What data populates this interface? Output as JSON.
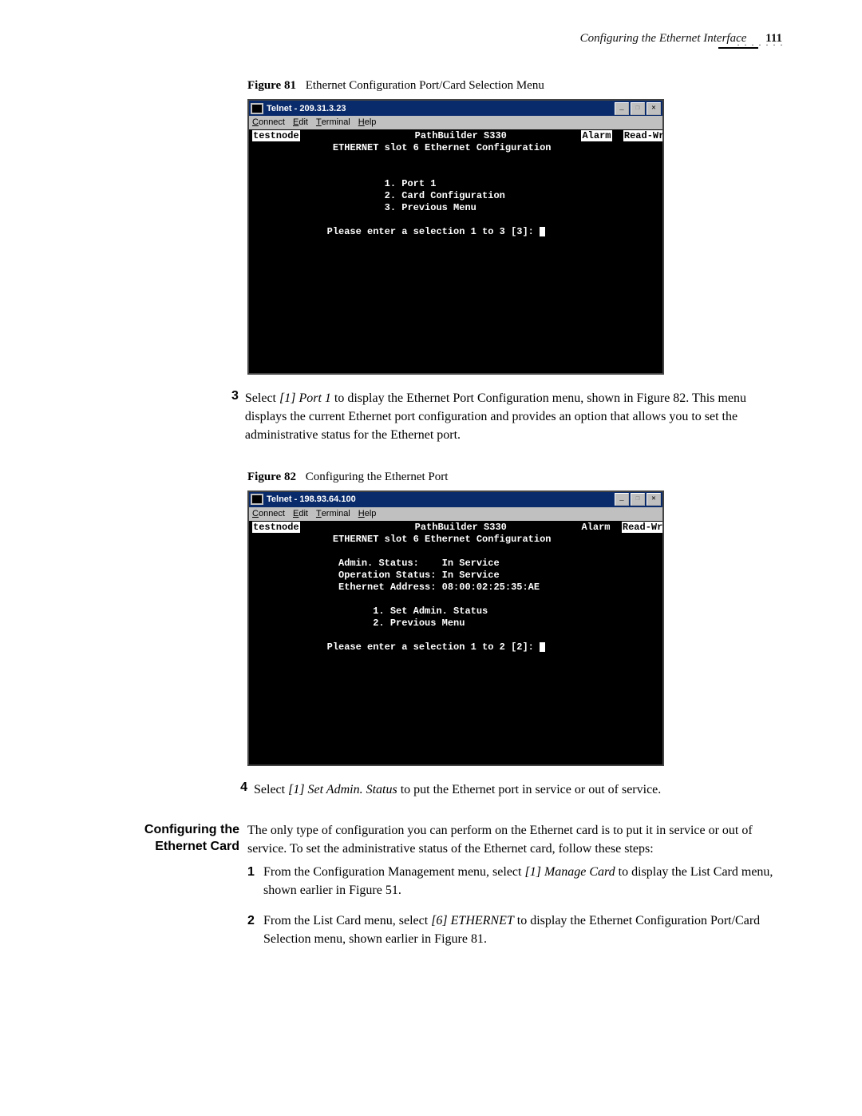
{
  "page": {
    "header_title": "Configuring the Ethernet Interface",
    "page_number": "111"
  },
  "fig81": {
    "caption_label": "Figure 81",
    "caption_text": "Ethernet Configuration Port/Card Selection Menu",
    "titlebar": "Telnet - 209.31.3.23",
    "menus": {
      "connect": "Connect",
      "edit": "Edit",
      "terminal": "Terminal",
      "help": "Help"
    },
    "winbtns": {
      "min": "_",
      "restore": "❐",
      "close": "✕"
    },
    "node": "testnode",
    "product": "PathBuilder S330",
    "alarm": "Alarm",
    "mode": "Read-Write",
    "context": "ETHERNET slot 6 Ethernet Configuration",
    "m1": "1. Port 1",
    "m2": "2. Card Configuration",
    "m3": "3. Previous Menu",
    "prompt": "Please enter a selection 1 to 3 [3]: "
  },
  "step3": {
    "n": "3",
    "pre": "Select ",
    "it": "[1] Port 1",
    "post": " to display the Ethernet Port Configuration menu, shown in Figure 82. This menu displays the current Ethernet port configuration and provides an option that allows you to set the administrative status for the Ethernet port."
  },
  "fig82": {
    "caption_label": "Figure 82",
    "caption_text": "Configuring the Ethernet Port",
    "titlebar": "Telnet - 198.93.64.100",
    "menus": {
      "connect": "Connect",
      "edit": "Edit",
      "terminal": "Terminal",
      "help": "Help"
    },
    "winbtns": {
      "min": "_",
      "restore": "❐",
      "close": "✕"
    },
    "node": "testnode",
    "product": "PathBuilder S330",
    "alarm": "Alarm",
    "mode": "Read-Write",
    "context": "ETHERNET slot 6 Ethernet Configuration",
    "s1": "Admin. Status:    In Service",
    "s2": "Operation Status: In Service",
    "s3": "Ethernet Address: 08:00:02:25:35:AE",
    "m1": "1. Set Admin. Status",
    "m2": "2. Previous Menu",
    "prompt": "Please enter a selection 1 to 2 [2]: "
  },
  "step4": {
    "n": "4",
    "pre": "Select ",
    "it": "[1] Set Admin. Status",
    "post": " to put the Ethernet port in service or out of service."
  },
  "section": {
    "heading": "Configuring the Ethernet Card",
    "body": "The only type of configuration you can perform on the Ethernet card is to put it in service or out of service. To set the administrative status of the Ethernet card, follow these steps:"
  },
  "sub1": {
    "n": "1",
    "pre": "From the Configuration Management menu, select ",
    "it": "[1] Manage Card",
    "post": " to display the List Card menu, shown earlier in Figure 51."
  },
  "sub2": {
    "n": "2",
    "pre": "From the List Card menu, select ",
    "it": "[6] ETHERNET",
    "post": " to display the Ethernet Configuration Port/Card Selection menu, shown earlier in Figure 81."
  }
}
